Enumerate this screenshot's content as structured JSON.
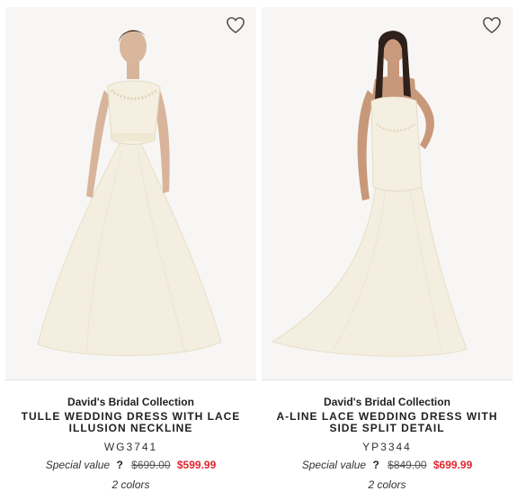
{
  "products": [
    {
      "brand": "David's Bridal Collection",
      "title": "Tulle Wedding Dress with Lace Illusion Neckline",
      "sku": "WG3741",
      "special_label": "Special value",
      "help_label": "?",
      "original_price": "$699.00",
      "sale_price": "$599.99",
      "colors": "2 colors",
      "icon": "heart-icon"
    },
    {
      "brand": "David's Bridal Collection",
      "title": "A-Line Lace Wedding Dress with Side Split Detail",
      "sku": "YP3344",
      "special_label": "Special value",
      "help_label": "?",
      "original_price": "$849.00",
      "sale_price": "$699.99",
      "colors": "2 colors",
      "icon": "heart-icon"
    }
  ],
  "colors": {
    "sale": "#e0262f",
    "text": "#222222",
    "photo_bg": "#f7f5f3",
    "dress": "#f4efe0"
  }
}
